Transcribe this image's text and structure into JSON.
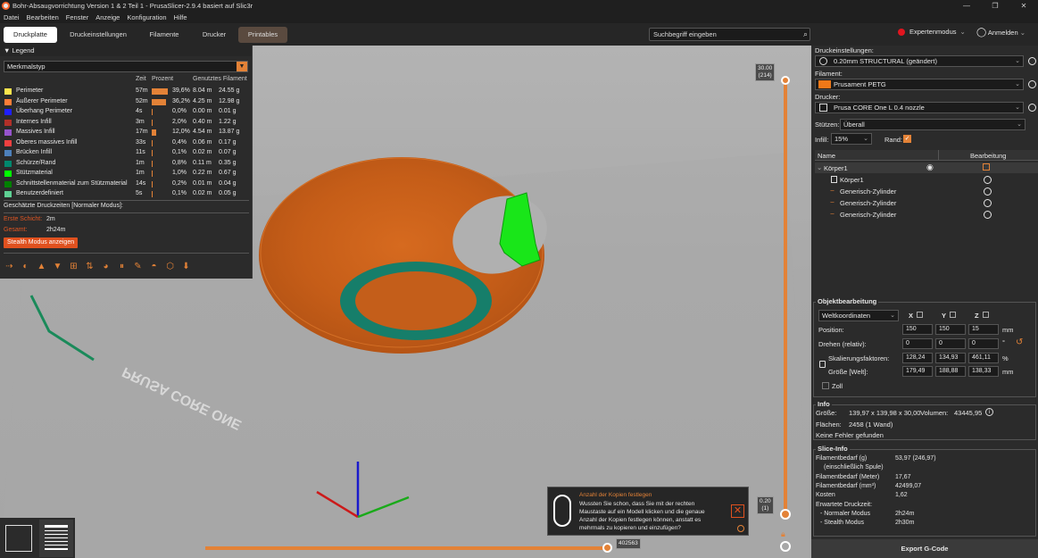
{
  "window": {
    "title": "Bohr-Absaugvorrichtung Version 1 & 2 Teil 1 - PrusaSlicer-2.9.4 basiert auf Slic3r",
    "buttons": [
      "—",
      "❐",
      "✕"
    ]
  },
  "menu": [
    "Datei",
    "Bearbeiten",
    "Fenster",
    "Anzeige",
    "Konfiguration",
    "Hilfe"
  ],
  "tabs": [
    "Druckplatte",
    "Druckeinstellungen",
    "Filamente",
    "Drucker",
    "Printables"
  ],
  "search": {
    "placeholder": "Suchbegriff eingeben"
  },
  "topright": {
    "mode": "Expertenmodus",
    "login": "Anmelden"
  },
  "legend": {
    "header": "Legend",
    "select": "Merkmalstyp",
    "columns": {
      "time": "Zeit",
      "percent": "Prozent",
      "filament": "Genutztes Filament"
    },
    "rows": [
      {
        "name": "Perimeter",
        "color": "#ffe54d",
        "time": "57m",
        "percent": "39,6%",
        "pct": 39.6,
        "len": "8.04 m",
        "weight": "24.55 g"
      },
      {
        "name": "Äußerer Perimeter",
        "color": "#ff7d38",
        "time": "52m",
        "percent": "36,2%",
        "pct": 36.2,
        "len": "4.25 m",
        "weight": "12.98 g"
      },
      {
        "name": "Überhang Perimeter",
        "color": "#1f1fff",
        "time": "4s",
        "percent": "0,0%",
        "pct": 0.0,
        "len": "0.00 m",
        "weight": "0.01 g"
      },
      {
        "name": "Internes Infill",
        "color": "#b03029",
        "time": "3m",
        "percent": "2,0%",
        "pct": 2.0,
        "len": "0.40 m",
        "weight": "1.22 g"
      },
      {
        "name": "Massives Infill",
        "color": "#9654cc",
        "time": "17m",
        "percent": "12,0%",
        "pct": 12.0,
        "len": "4.54 m",
        "weight": "13.87 g"
      },
      {
        "name": "Oberes massives Infill",
        "color": "#f04040",
        "time": "33s",
        "percent": "0,4%",
        "pct": 0.4,
        "len": "0.06 m",
        "weight": "0.17 g"
      },
      {
        "name": "Brücken Infill",
        "color": "#4d80ba",
        "time": "11s",
        "percent": "0,1%",
        "pct": 0.1,
        "len": "0.02 m",
        "weight": "0.07 g"
      },
      {
        "name": "Schürze/Rand",
        "color": "#00876e",
        "time": "1m",
        "percent": "0,8%",
        "pct": 0.8,
        "len": "0.11 m",
        "weight": "0.35 g"
      },
      {
        "name": "Stützmaterial",
        "color": "#00ff00",
        "time": "1m",
        "percent": "1,0%",
        "pct": 1.0,
        "len": "0.22 m",
        "weight": "0.67 g"
      },
      {
        "name": "Schnittstellenmaterial zum Stützmaterial",
        "color": "#008000",
        "time": "14s",
        "percent": "0,2%",
        "pct": 0.2,
        "len": "0.01 m",
        "weight": "0.04 g"
      },
      {
        "name": "Benutzerdefiniert",
        "color": "#5ed194",
        "time": "5s",
        "percent": "0,1%",
        "pct": 0.1,
        "len": "0.02 m",
        "weight": "0.05 g"
      }
    ],
    "estimated": "Geschätzte Druckzeiten [Normaler Modus]:",
    "first_layer_label": "Erste Schicht:",
    "first_layer": "2m",
    "total_label": "Gesamt:",
    "total": "2h24m",
    "stealth_button": "Stealth Modus anzeigen"
  },
  "slider": {
    "top_value": "30.00",
    "top_layer": "(214)",
    "bottom_value": "0.20",
    "bottom_layer": "(1)",
    "h_value": "402563"
  },
  "hint": {
    "title": "Anzahl der Kopien festlegen",
    "text1": "Wussten Sie schon, dass Sie mit der rechten",
    "text2": "Maustaste auf ein Modell klicken und die genaue",
    "text3": "Anzahl der Kopien festlegen können, anstatt es",
    "text4": "mehrmals zu kopieren und einzufügen?"
  },
  "right": {
    "print_label": "Druckeinstellungen:",
    "print_value": "0.20mm STRUCTURAL (geändert)",
    "filament_label": "Filament:",
    "filament_value": "Prusament PETG",
    "printer_label": "Drucker:",
    "printer_value": "Prusa CORE One L 0.4 nozzle",
    "supports_label": "Stützen:",
    "supports_value": "Überall",
    "infill_label": "Infill:",
    "infill_value": "15%",
    "brim_label": "Rand:",
    "tree_col_name": "Name",
    "tree_col_edit": "Bearbeitung",
    "tree": [
      "Körper1",
      "Körper1",
      "Generisch-Zylinder",
      "Generisch-Zylinder",
      "Generisch-Zylinder"
    ],
    "obj_title": "Objektbearbeitung",
    "coords": "Weltkoordinaten",
    "axis_x": "X",
    "axis_y": "Y",
    "axis_z": "Z",
    "position_label": "Position:",
    "position": [
      "150",
      "150",
      "15"
    ],
    "rotate_label": "Drehen (relativ):",
    "rotate": [
      "0",
      "0",
      "0"
    ],
    "scale_label": "Skalierungsfaktoren:",
    "scale": [
      "128,24",
      "134,93",
      "461,11"
    ],
    "size_label": "Größe [Welt]:",
    "size": [
      "179,49",
      "188,88",
      "138,33"
    ],
    "unit_mm": "mm",
    "unit_deg": "°",
    "unit_pct": "%",
    "inch_label": "Zoll",
    "info_title": "Info",
    "info_size_label": "Größe:",
    "info_size": "139,97 x 139,98 x 30,00",
    "info_volume_label": "Volumen:",
    "info_volume": "43445,95",
    "info_faces_label": "Flächen:",
    "info_faces": "2458 (1 Wand)",
    "info_errors": "Keine Fehler gefunden",
    "slice_title": "Slice-Info",
    "slice": [
      {
        "label": "Filamentbedarf (g)",
        "value": "53,97 (246,97)"
      },
      {
        "label": "(einschließlich Spule)",
        "value": ""
      },
      {
        "label": "Filamentbedarf (Meter)",
        "value": "17,67"
      },
      {
        "label": "Filamentbedarf (mm³)",
        "value": "42499,07"
      },
      {
        "label": "Kosten",
        "value": "1,62"
      },
      {
        "label": "Erwartete Druckzeit:",
        "value": ""
      },
      {
        "label": "- Normaler Modus",
        "value": "2h24m"
      },
      {
        "label": "- Stealth Modus",
        "value": "2h30m"
      }
    ],
    "export": "Export G-Code"
  }
}
